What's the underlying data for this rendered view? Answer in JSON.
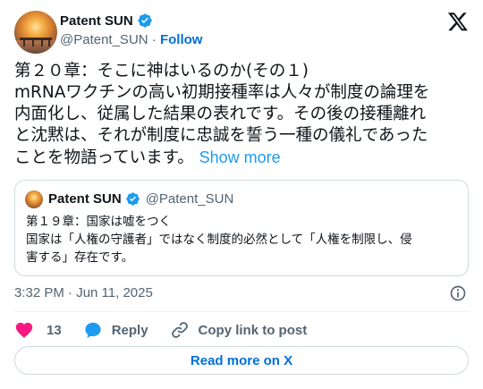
{
  "author": {
    "display_name": "Patent SUN",
    "handle": "@Patent_SUN",
    "separator": " · ",
    "follow_label": "Follow"
  },
  "tweet": {
    "lines": [
      "第２０章：そこに神はいるのか(その１)",
      "mRNAワクチンの高い初期接種率は人々が制度の論理を",
      "内面化し、従属した結果の表れです。その後の接種離れ",
      "と沈黙は、それが制度に忠誠を誓う一種の儀礼であった",
      "ことを物語っています。"
    ],
    "show_more_label": "Show more",
    "timestamp": "3:32 PM · Jun 11, 2025"
  },
  "quoted_tweet": {
    "display_name": "Patent SUN",
    "handle": "@Patent_SUN",
    "lines": [
      "第１９章：国家は嘘をつく",
      "国家は「人権の守護者」ではなく制度的必然として「人権を制限し、侵",
      "害する」存在です。"
    ]
  },
  "actions": {
    "like_count": "13",
    "reply_label": "Reply",
    "copy_link_label": "Copy link to post"
  },
  "read_more_label": "Read more on X",
  "colors": {
    "accent": "#1d9bf0",
    "link": "#006fd6",
    "like": "#f91880",
    "text": "#0f1419",
    "muted": "#536471",
    "border": "#cfd9de"
  },
  "icons": [
    "verified-badge-icon",
    "x-logo-icon",
    "info-icon",
    "heart-icon",
    "reply-bubble-icon",
    "link-icon"
  ]
}
